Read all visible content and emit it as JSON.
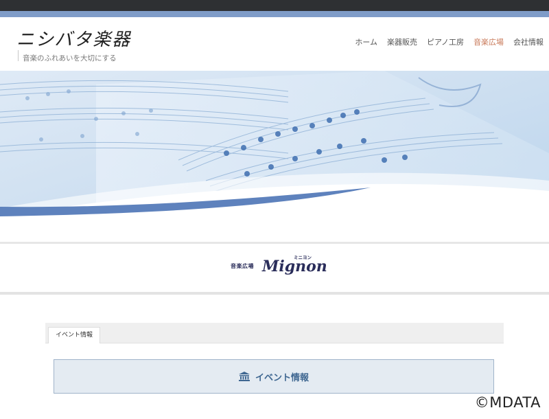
{
  "header": {
    "site_title": "ニシバタ楽器",
    "tagline": "音楽のふれあいを大切にする"
  },
  "nav": {
    "items": [
      {
        "label": "ホーム"
      },
      {
        "label": "楽器販売"
      },
      {
        "label": "ピアノ工房"
      },
      {
        "label": "音楽広場"
      },
      {
        "label": "会社情報"
      }
    ],
    "active_index": 3,
    "active_color": "#c97a5a"
  },
  "logo": {
    "prefix": "音楽広場",
    "name": "Mignon",
    "ruby": "ミニヨン"
  },
  "tabs": [
    {
      "label": "イベント情報"
    }
  ],
  "event_section": {
    "heading": "イベント情報",
    "icon": "building-icon"
  },
  "watermark": "©MDATA",
  "colors": {
    "top_bar": "#2e3033",
    "accent_bar": "#7f9cc8",
    "event_box_bg": "#e4ebf2",
    "event_text": "#3f6791",
    "logo": "#2a2d5a"
  }
}
